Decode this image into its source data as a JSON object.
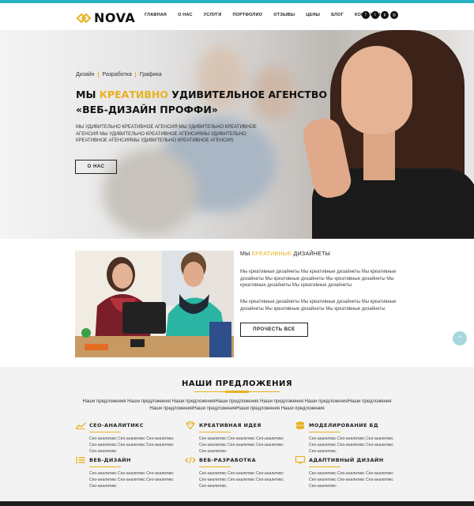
{
  "brand": {
    "name": "NOVA",
    "accent": "#e9b120",
    "topline": "#27b3c4"
  },
  "nav": [
    "ГЛАВНАЯ",
    "О НАС",
    "УСЛУГИ",
    "ПОРТФОЛИО",
    "ОТЗЫВЫ",
    "ЦЕНЫ",
    "БЛОГ",
    "КОНТАКТЫ"
  ],
  "socials": [
    {
      "icon": "facebook-icon",
      "glyph": "f"
    },
    {
      "icon": "twitter-icon",
      "glyph": "t"
    },
    {
      "icon": "pinterest-icon",
      "glyph": "p"
    },
    {
      "icon": "instagram-icon",
      "glyph": "◎"
    }
  ],
  "hero": {
    "tags": [
      "Дизайн",
      "Разработка",
      "Графика"
    ],
    "title_pre": "МЫ ",
    "title_accent": "КРЕАТИВНО",
    "title_post": " УДИВИТЕЛЬНОЕ АГЕНСТВО «ВЕБ-ДИЗАЙН ПРОФФИ»",
    "text": "МЫ УДИВИТЕЛЬНО КРЕАТИВНОЕ АГЕНСИЯ МЫ УДИВИТЕЛЬНО КРЕАТИВНОЕ АГЕНСИЯ МЫ УДИВИТЕЛЬНО КРЕАТИВНОЕ АГЕНСИЯМЫ УДИВИТЕЛЬНО КРЕАТИВНОЕ АГЕНСИЯМЫ УДИВИТЕЛЬНО КРЕАТИВНОЕ АГЕНСИЯ.",
    "button": "О НАС"
  },
  "about": {
    "title_pre": "МЫ ",
    "title_accent": "КРЕАТИВНЫЕ",
    "title_post": " ДИЗАЙНЕТЫ",
    "p1": "Мы креативные дизайнеты Мы креативные дизайнеты Мы креативные дизайнеты Мы креативные дизайнеты Мы креативные дизайнеты Мы креативные дизайнеты Мы креативные дизайнеты",
    "p2": "Мы креативные дизайнеты Мы креативные дизайнеты Мы креативные дизайнеты Мы креативные дизайнеты Мы креативные дизайнеты",
    "button": "ПРОЧЕСТЬ ВСЕ"
  },
  "scroll_top": "⌃",
  "offers": {
    "title": "НАШИ ПРЕДЛОЖЕНИЯ",
    "subtitle": "Наши предложения Наши предложения Наши предложенияНаши предложения Наши предложения Наши предложенияНаши предложения Наши предложенияНаши предложенияНаши предложения Наши предложения",
    "features": [
      {
        "icon": "chart-icon",
        "title": "СЕО-АНАЛИТИКС",
        "text": "Сео-аналитикс Сео-аналитикс Сео-аналитикс Сео-аналитикс Сео-аналитикс Сео-аналитикс Сео-аналитикс"
      },
      {
        "icon": "diamond-icon",
        "title": "КРЕАТИВНАЯ ИДЕЯ",
        "text": "Сео-аналитикс Сео-аналитикс Сео-аналитикс Сео-аналитикс Сео-аналитикс Сео-аналитикс Сео-аналитикс"
      },
      {
        "icon": "database-icon",
        "title": "МОДЕЛИРОВАНИЕ БД",
        "text": "Сео-аналитикс Сео-аналитикс Сео-аналитикс Сео-аналитикс Сео-аналитикс Сео-аналитикс Сео-аналитикс"
      },
      {
        "icon": "list-icon",
        "title": "ВЕБ-ДИЗАЙН",
        "text": "Сео-аналитикс Сео-аналитикс Сео-аналитикс Сео-аналитикс Сео-аналитикс Сео-аналитикс Сео-аналитикс"
      },
      {
        "icon": "code-icon",
        "title": "ВЕБ-РАЗРАБОТКА",
        "text": "Сео-аналитикс Сео-аналитикс Сео-аналитикс Сео-аналитикс Сео-аналитикс Сео-аналитикс Сео-аналитикс"
      },
      {
        "icon": "monitor-icon",
        "title": "АДАПТИВНЫЙ ДИЗАЙН",
        "text": "Сео-аналитикс Сео-аналитикс Сео-аналитикс Сео-аналитикс Сео-аналитикс Сео-аналитикс Сео-аналитикс"
      }
    ]
  }
}
